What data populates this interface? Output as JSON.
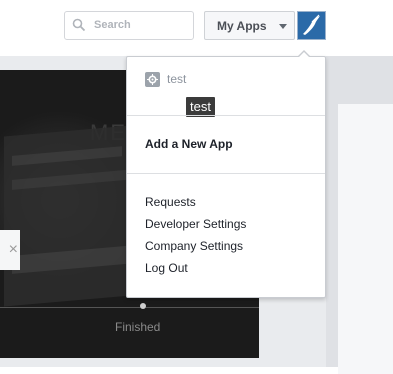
{
  "header": {
    "search_placeholder": "Search",
    "my_apps_label": "My Apps",
    "search_icon": "search-icon",
    "avatar_icon": "avatar-icon"
  },
  "background": {
    "video_caption": "Finished",
    "ghost_text": "ME",
    "close_glyph": "×"
  },
  "dropdown": {
    "app": {
      "name": "test",
      "icon": "gear-icon",
      "tooltip": "test"
    },
    "add_app_label": "Add a New App",
    "items": [
      {
        "label": "Requests"
      },
      {
        "label": "Developer Settings"
      },
      {
        "label": "Company Settings"
      },
      {
        "label": "Log Out"
      }
    ]
  },
  "colors": {
    "accent": "#2b6aa8",
    "text": "#1d2129",
    "muted": "#8d949e"
  }
}
